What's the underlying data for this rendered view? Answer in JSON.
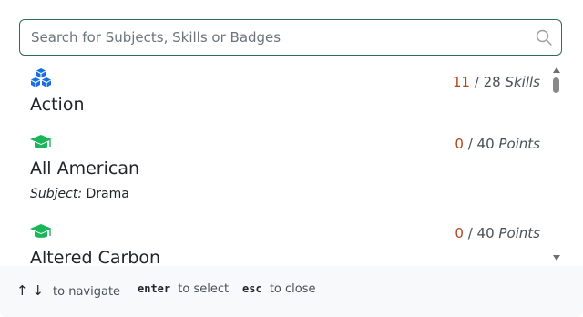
{
  "search": {
    "placeholder": "Search for Subjects, Skills or Badges",
    "value": ""
  },
  "results": [
    {
      "icon": "cubes-icon",
      "icon_color": "#1a6fe0",
      "title": "Action",
      "count": "11",
      "separator": "/",
      "total": "28",
      "unit": "Skills"
    },
    {
      "icon": "graduation-cap-icon",
      "icon_color": "#1bb65a",
      "title": "All American",
      "count": "0",
      "separator": "/",
      "total": "40",
      "unit": "Points",
      "subject_label": "Subject:",
      "subject_value": "Drama"
    },
    {
      "icon": "graduation-cap-icon",
      "icon_color": "#1bb65a",
      "title": "Altered Carbon",
      "count": "0",
      "separator": "/",
      "total": "40",
      "unit": "Points"
    }
  ],
  "footer": {
    "navigate_keys": "↑ ↓",
    "navigate_label": "to navigate",
    "enter_key": "enter",
    "enter_label": "to select",
    "esc_key": "esc",
    "esc_label": "to close"
  },
  "colors": {
    "border": "#2e6d57",
    "count": "#b5451b",
    "cubes": "#1a6fe0",
    "cap": "#1bb65a"
  }
}
